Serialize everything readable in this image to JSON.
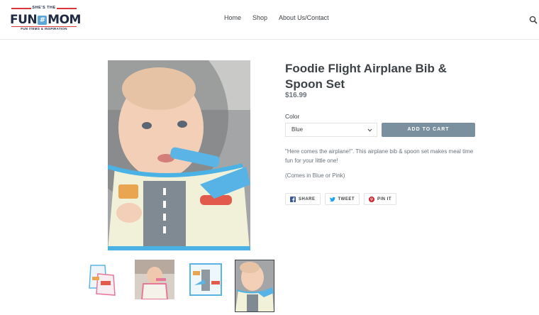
{
  "logo": {
    "top": "SHE'S THE",
    "main_left": "FUN",
    "main_hash": "#",
    "main_right": "MOM",
    "sub": "FUN ITEMS & INSPIRATION"
  },
  "nav": {
    "items": [
      "Home",
      "Shop",
      "About Us/Contact"
    ]
  },
  "product": {
    "title": "Foodie Flight Airplane Bib & Spoon Set",
    "price": "$16.99",
    "color_label": "Color",
    "color_selected": "Blue",
    "add_to_cart": "ADD TO CART",
    "description": "\"Here comes the airplane!\". This airplane bib & spoon set makes meal time fun for your little one!",
    "note": "(Comes in Blue or Pink)"
  },
  "share": {
    "share": "SHARE",
    "tweet": "TWEET",
    "pin": "PIN IT"
  },
  "colors": {
    "accent_button": "#7b909f",
    "text": "#3d4246",
    "muted": "#69727b",
    "logo_navy": "#1f2a44",
    "logo_red": "#d9363e",
    "logo_blue": "#5aa6da",
    "facebook": "#3b5998",
    "twitter": "#1da1f2",
    "pinterest": "#cb2027"
  }
}
